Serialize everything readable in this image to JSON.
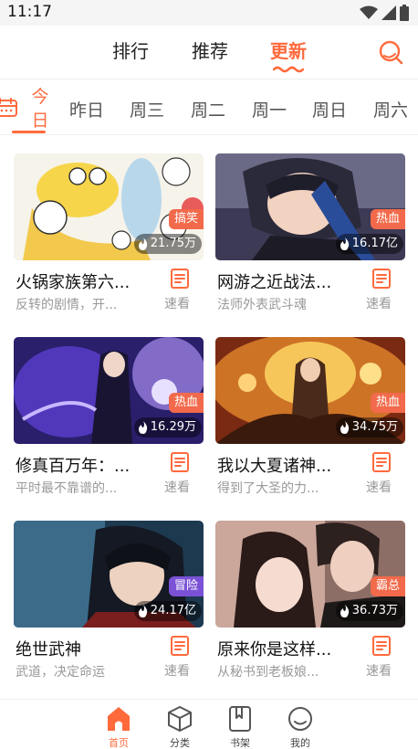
{
  "status_bar": {
    "time": "11:17",
    "icons": [
      "wifi-icon",
      "signal-icon",
      "battery-icon"
    ]
  },
  "top_nav": {
    "tabs": [
      {
        "label": "排行",
        "active": false
      },
      {
        "label": "推荐",
        "active": false
      },
      {
        "label": "更新",
        "active": true
      }
    ],
    "search_icon": "search-icon"
  },
  "day_tabs": {
    "calendar_icon": "calendar-icon",
    "active": {
      "char1": "今",
      "char2": "日"
    },
    "items": [
      "昨日",
      "周三",
      "周二",
      "周一",
      "周日",
      "周六"
    ]
  },
  "comics": [
    {
      "title": "火锅家族第六...",
      "desc": "反转的剧情，开...",
      "tag": "搞笑",
      "heat": "21.75万",
      "read_label": "速看"
    },
    {
      "title": "网游之近战法...",
      "desc": "法师外表武斗魂",
      "tag": "热血",
      "heat": "16.17亿",
      "read_label": "速看"
    },
    {
      "title": "修真百万年：...",
      "desc": "平时最不靠谱的...",
      "tag": "热血",
      "heat": "16.29万",
      "read_label": "速看"
    },
    {
      "title": "我以大夏诸神...",
      "desc": "得到了大圣的力...",
      "tag": "热血",
      "heat": "34.75万",
      "read_label": "速看"
    },
    {
      "title": "绝世武神",
      "desc": "武道，决定命运",
      "tag": "冒险",
      "heat": "24.17亿",
      "read_label": "速看"
    },
    {
      "title": "原来你是这样...",
      "desc": "从秘书到老板娘...",
      "tag": "霸总",
      "heat": "36.73万",
      "read_label": "速看"
    }
  ],
  "bottom_nav": [
    {
      "label": "首页",
      "icon": "home-icon",
      "active": true
    },
    {
      "label": "分类",
      "icon": "category-cube-icon",
      "active": false
    },
    {
      "label": "书架",
      "icon": "bookshelf-icon",
      "active": false
    },
    {
      "label": "我的",
      "icon": "profile-smile-icon",
      "active": false
    }
  ],
  "colors": {
    "accent": "#ff6a3d",
    "tag_hot": "#f26a4b",
    "tag_adventure": "#7b52d6"
  }
}
